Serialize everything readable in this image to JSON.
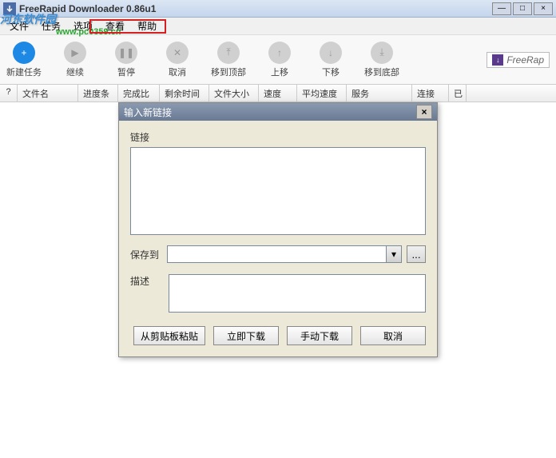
{
  "window": {
    "title": "FreeRapid Downloader 0.86u1",
    "min": "—",
    "max": "□",
    "close": "×"
  },
  "watermark": {
    "text1": "河东软件园",
    "text2": "www.pc0359.cn"
  },
  "menu": {
    "file": "文件",
    "tasks": "任务",
    "options": "选项",
    "view": "查看",
    "help": "帮助"
  },
  "toolbar": {
    "new": "新建任务",
    "resume": "继续",
    "pause": "暂停",
    "cancel": "取消",
    "top": "移到顶部",
    "up": "上移",
    "down": "下移",
    "bottom": "移到底部",
    "brand": "FreeRap"
  },
  "columns": {
    "idx": "?",
    "filename": "文件名",
    "progress": "进度条",
    "percent": "完成比",
    "eta": "剩余时间",
    "size": "文件大小",
    "speed": "速度",
    "avgspeed": "平均速度",
    "service": "服务",
    "conn": "连接",
    "last": "已"
  },
  "dialog": {
    "title": "输入新链接",
    "close": "×",
    "links_label": "链接",
    "links_value": "",
    "saveto_label": "保存到",
    "saveto_value": "",
    "browse_label": "...",
    "desc_label": "描述",
    "desc_value": "",
    "btn_paste": "从剪贴板粘贴",
    "btn_start": "立即下载",
    "btn_manual": "手动下载",
    "btn_cancel": "取消"
  },
  "icons": {
    "plus": "+",
    "play": "▶",
    "pause": "❚❚",
    "cancel": "✕",
    "top": "⤒",
    "up": "↑",
    "down": "↓",
    "bottom": "⤓",
    "dropdown": "▾",
    "dlarrow": "↓"
  }
}
